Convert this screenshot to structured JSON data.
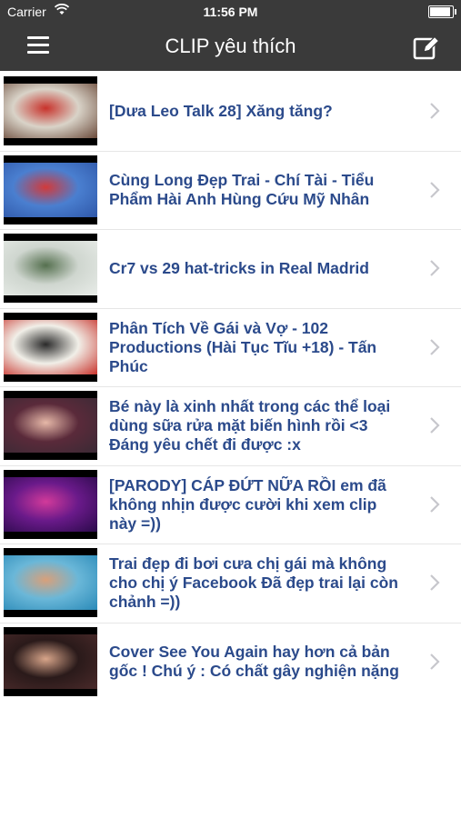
{
  "status": {
    "carrier": "Carrier",
    "time": "11:56 PM",
    "wifi_icon": "wifi-icon",
    "battery_level": 1.0
  },
  "nav": {
    "title": "CLIP yêu thích",
    "menu_icon": "hamburger-menu-icon",
    "edit_icon": "edit-icon"
  },
  "colors": {
    "bar": "#3a3a3a",
    "link": "#2b4a8b",
    "chevron": "#c7c7cc"
  },
  "items": [
    {
      "title": "[Dưa Leo Talk 28] Xăng tăng?",
      "thumb_colors": [
        "#d9d3c8",
        "#c8322b",
        "#6b4a3a"
      ]
    },
    {
      "title": "Cùng Long Đẹp Trai - Chí Tài - Tiểu Phẩm Hài Anh Hùng Cứu Mỹ Nhân",
      "thumb_colors": [
        "#4a7fd0",
        "#d23a3a",
        "#2f57a8"
      ]
    },
    {
      "title": "Cr7 vs 29 hat-tricks in Real Madrid",
      "thumb_colors": [
        "#cfd6cf",
        "#55704f",
        "#e8ece8"
      ]
    },
    {
      "title": "Phân Tích Về Gái và Vợ - 102 Productions (Hài Tục Tĩu +18) - Tấn Phúc",
      "thumb_colors": [
        "#f1efe8",
        "#2a2a2a",
        "#c8322b"
      ]
    },
    {
      "title": "Bé này là xinh nhất trong các thể loại dùng sữa rửa mặt biến hình rồi <3 Đáng yêu chết đi được :x",
      "thumb_colors": [
        "#5a2a3a",
        "#e6b8a8",
        "#3a2a35"
      ]
    },
    {
      "title": "[PARODY] CÁP ĐỨT NỮA RỒI em đã không nhịn được cười khi xem clip này =))",
      "thumb_colors": [
        "#6a1a8a",
        "#d23a9a",
        "#2a0a4a"
      ]
    },
    {
      "title": "Trai đẹp đi bơi cưa chị gái mà không cho chị ý Facebook  Đã đẹp trai lại còn chảnh =))",
      "thumb_colors": [
        "#6ab7d8",
        "#d8a07a",
        "#2a8ab8"
      ]
    },
    {
      "title": "Cover See You Again hay hơn cả bản gốc ! Chú ý : Có chất gây nghiện nặng",
      "thumb_colors": [
        "#2a1a1a",
        "#d8a58a",
        "#4a2a2a"
      ]
    }
  ]
}
